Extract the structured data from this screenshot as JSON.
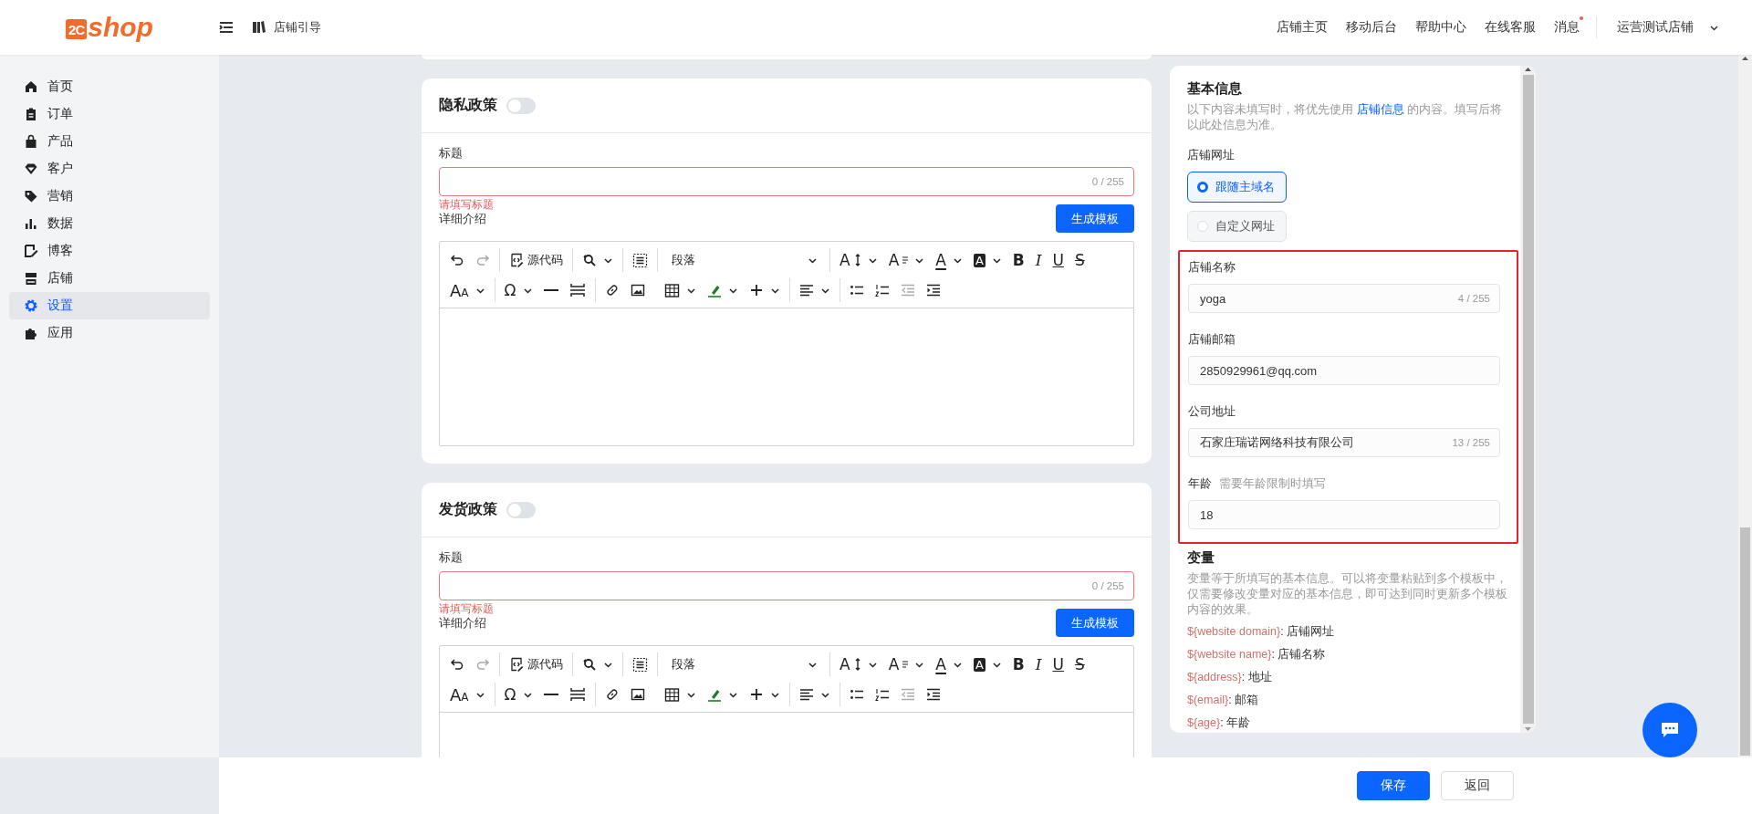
{
  "header": {
    "logo": {
      "badge": "2C",
      "text": "shop"
    },
    "guide": "店铺引导",
    "nav": [
      {
        "label": "店铺主页",
        "unread": false
      },
      {
        "label": "移动后台",
        "unread": false
      },
      {
        "label": "帮助中心",
        "unread": false
      },
      {
        "label": "在线客服",
        "unread": false
      },
      {
        "label": "消息",
        "unread": true
      }
    ],
    "store": "运营测试店铺"
  },
  "sidebar": {
    "items": [
      {
        "label": "首页",
        "selected": false
      },
      {
        "label": "订单",
        "selected": false
      },
      {
        "label": "产品",
        "selected": false
      },
      {
        "label": "客户",
        "selected": false
      },
      {
        "label": "营销",
        "selected": false
      },
      {
        "label": "数据",
        "selected": false
      },
      {
        "label": "博客",
        "selected": false
      },
      {
        "label": "店铺",
        "selected": false
      },
      {
        "label": "设置",
        "selected": true
      },
      {
        "label": "应用",
        "selected": false
      }
    ]
  },
  "policies": [
    {
      "title": "隐私政策",
      "enabled": false,
      "field_label": "标题",
      "counter": "0 / 255",
      "error": "请填写标题",
      "detail_label": "详细介绍",
      "generate_button": "生成模板",
      "toolbar": {
        "source_code": "源代码",
        "block_format": "段落",
        "font_size": "A",
        "line_height": "A",
        "text_color": "A",
        "background_color": "A",
        "bold": "B",
        "italic": "I",
        "underline": "U",
        "strikethrough": "S",
        "letter_case": "AA",
        "special_character": "Ω"
      }
    },
    {
      "title": "发货政策",
      "enabled": false,
      "field_label": "标题",
      "counter": "0 / 255",
      "error": "请填写标题",
      "detail_label": "详细介绍",
      "generate_button": "生成模板",
      "toolbar": {
        "source_code": "源代码",
        "block_format": "段落",
        "font_size": "A",
        "line_height": "A",
        "text_color": "A",
        "background_color": "A",
        "bold": "B",
        "italic": "I",
        "underline": "U",
        "strikethrough": "S",
        "letter_case": "AA",
        "special_character": "Ω"
      }
    }
  ],
  "basic_info": {
    "title": "基本信息",
    "description_before": "以下内容未填写时，将优先使用 ",
    "description_link": "店铺信息",
    "description_after": " 的内容。填写后将以此处信息为准。",
    "url_label": "店铺网址",
    "url_options": [
      {
        "label": "跟随主域名",
        "selected": true
      },
      {
        "label": "自定义网址",
        "selected": false
      }
    ],
    "fields": [
      {
        "label": "店铺名称",
        "value": "yoga",
        "counter": "4 / 255"
      },
      {
        "label": "店铺邮箱",
        "value": "2850929961@qq.com"
      },
      {
        "label": "公司地址",
        "value": "石家庄瑞诺网络科技有限公司",
        "counter": "13 / 255"
      },
      {
        "label": "年龄",
        "hint": "需要年龄限制时填写",
        "value": "18"
      }
    ]
  },
  "variables": {
    "title": "变量",
    "description": "变量等于所填写的基本信息。可以将变量粘贴到多个模板中，仅需要修改变量对应的基本信息，即可达到同时更新多个模板内容的效果。",
    "items": [
      {
        "token": "${website domain}",
        "meaning": ": 店铺网址"
      },
      {
        "token": "${website name}",
        "meaning": ": 店铺名称"
      },
      {
        "token": "${address}",
        "meaning": ": 地址"
      },
      {
        "token": "$(email}",
        "meaning": ": 邮箱"
      },
      {
        "token": "${age}",
        "meaning": ": 年龄"
      }
    ]
  },
  "footer": {
    "save": "保存",
    "back": "返回"
  }
}
